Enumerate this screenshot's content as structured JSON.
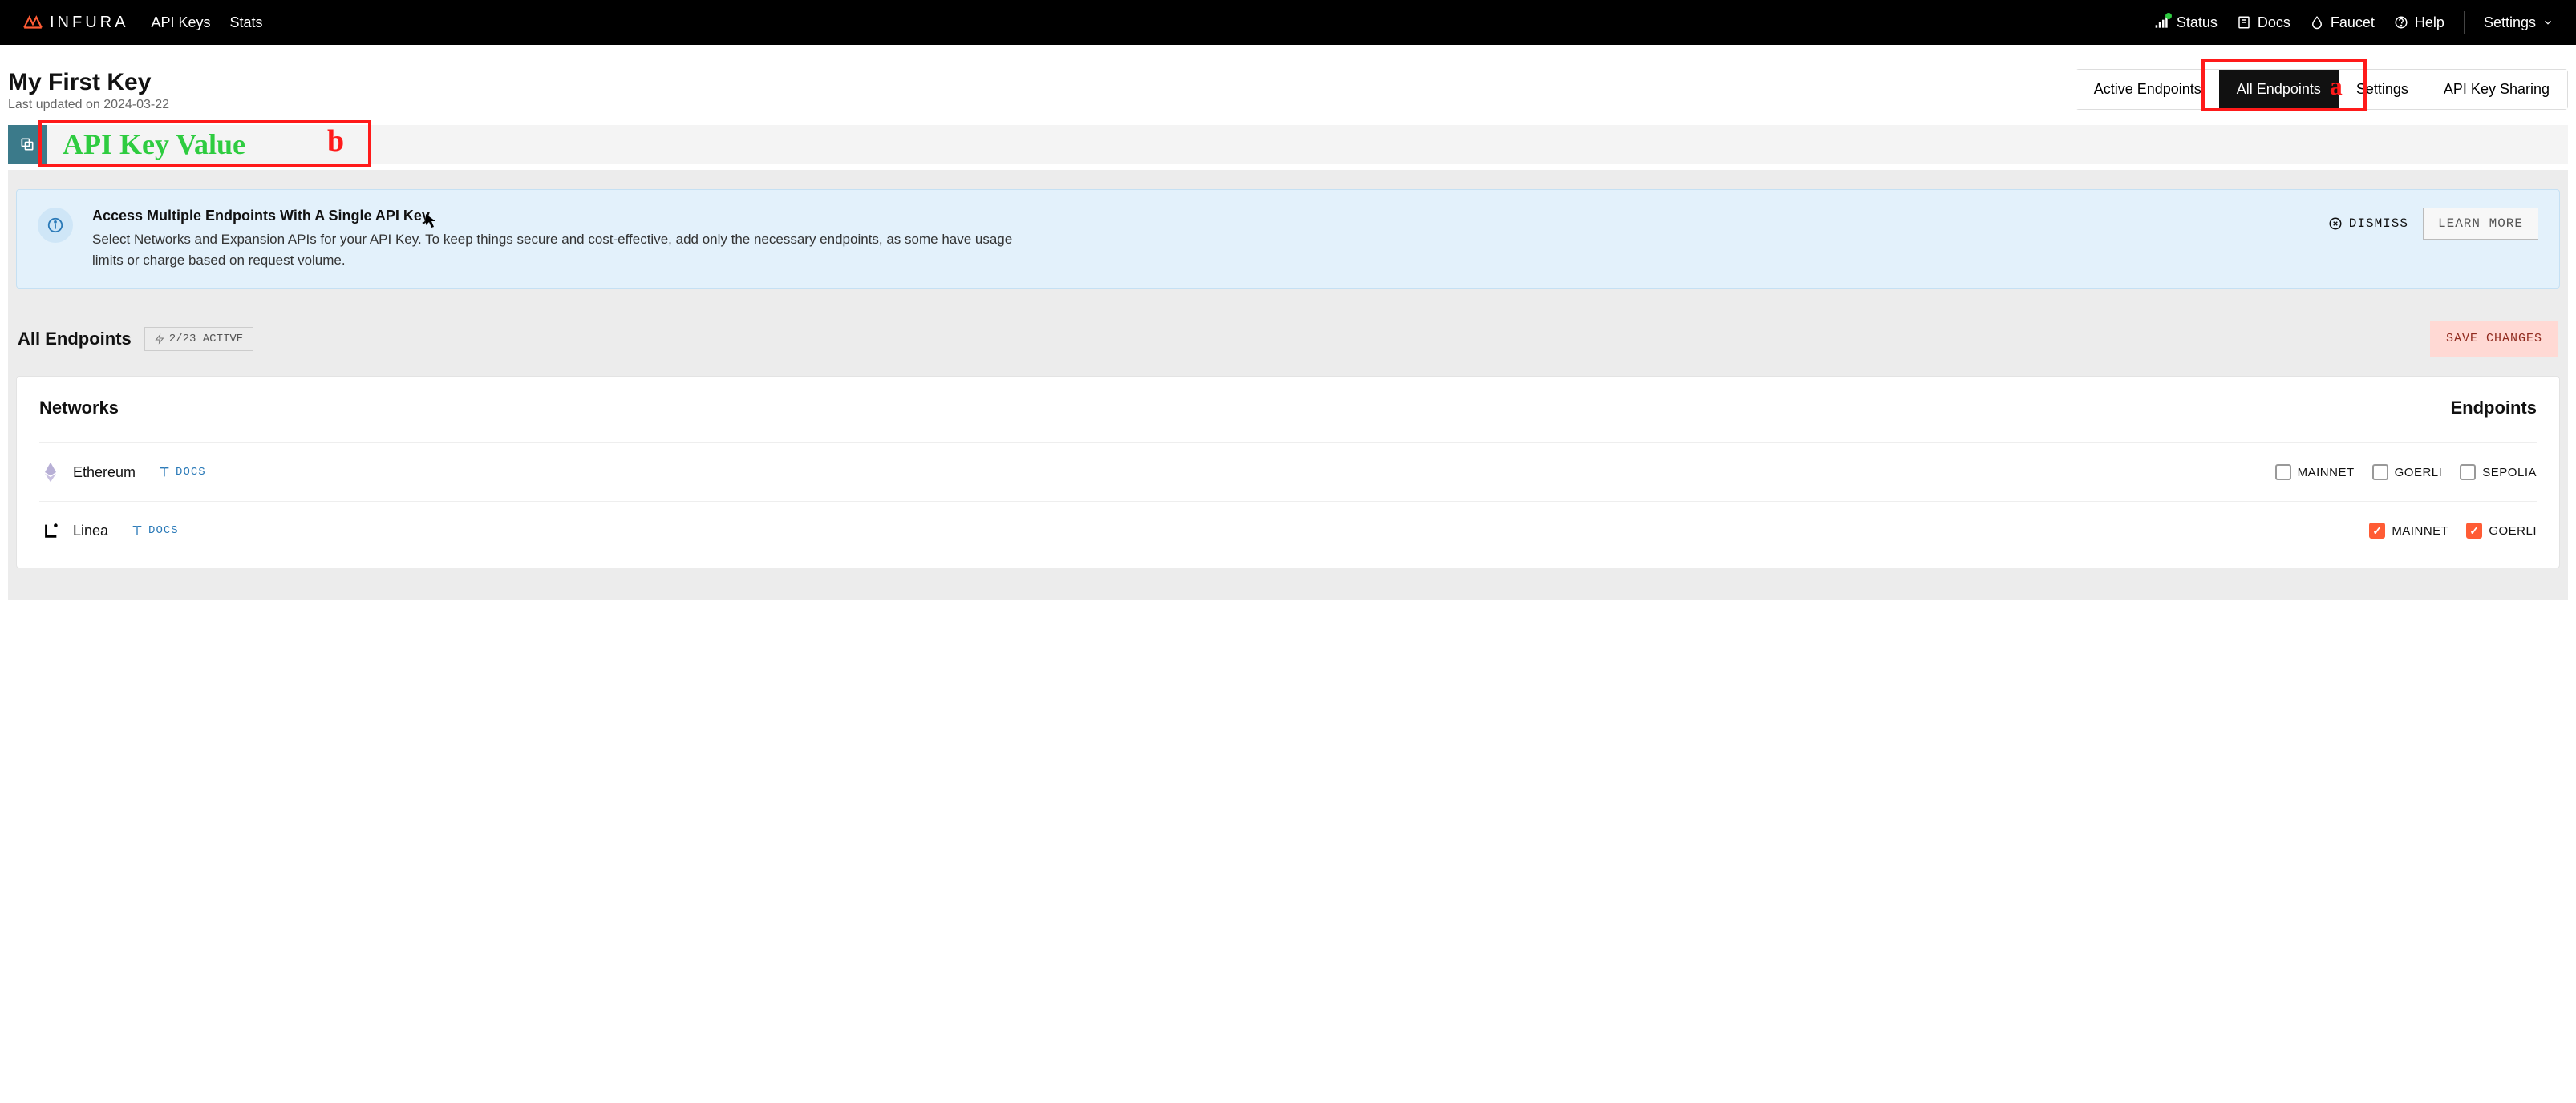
{
  "brand": {
    "name": "INFURA"
  },
  "nav": {
    "left": [
      {
        "label": "API Keys"
      },
      {
        "label": "Stats"
      }
    ],
    "right": {
      "status": "Status",
      "docs": "Docs",
      "faucet": "Faucet",
      "help": "Help",
      "settings": "Settings"
    }
  },
  "page": {
    "title": "My First Key",
    "updated": "Last updated on 2024-03-22"
  },
  "tabs": [
    {
      "label": "Active Endpoints",
      "active": false
    },
    {
      "label": "All Endpoints",
      "active": true
    },
    {
      "label": "Settings",
      "active": false
    },
    {
      "label": "API Key Sharing",
      "active": false
    }
  ],
  "annotations": {
    "a": "a",
    "b": "b"
  },
  "api_key": {
    "display": "API Key Value"
  },
  "banner": {
    "title": "Access Multiple Endpoints With A Single API Key",
    "body": "Select Networks and Expansion APIs for your API Key. To keep things secure and cost-effective, add only the necessary endpoints, as some have usage limits or charge based on request volume.",
    "dismiss": "DISMISS",
    "learn": "LEARN MORE"
  },
  "section": {
    "title": "All Endpoints",
    "active_count": "2/23 ACTIVE",
    "save": "SAVE CHANGES"
  },
  "table": {
    "col_networks": "Networks",
    "col_endpoints": "Endpoints",
    "docs_label": "DOCS",
    "rows": [
      {
        "name": "Ethereum",
        "endpoints": [
          {
            "label": "MAINNET",
            "checked": false
          },
          {
            "label": "GOERLI",
            "checked": false
          },
          {
            "label": "SEPOLIA",
            "checked": false
          }
        ]
      },
      {
        "name": "Linea",
        "endpoints": [
          {
            "label": "MAINNET",
            "checked": true
          },
          {
            "label": "GOERLI",
            "checked": true
          }
        ]
      }
    ]
  }
}
